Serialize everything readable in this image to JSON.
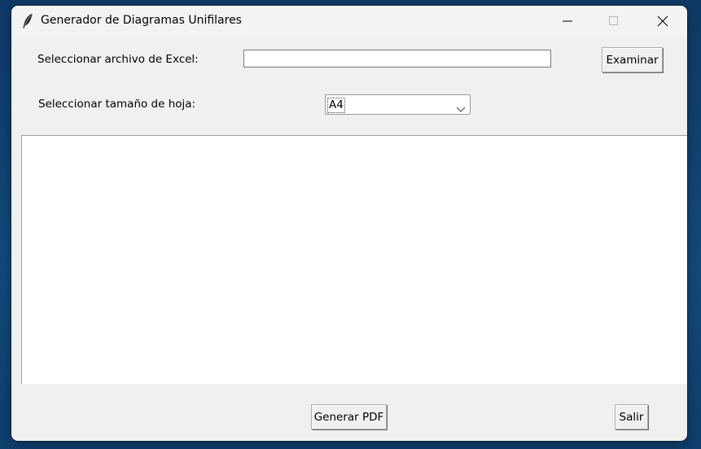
{
  "window": {
    "title": "Generador de Diagramas Unifilares",
    "app_icon": "feather-icon",
    "controls": {
      "minimize_icon": "minimize-icon",
      "maximize_icon": "maximize-icon",
      "close_icon": "close-icon"
    }
  },
  "form": {
    "excel_label": "Seleccionar archivo de Excel:",
    "excel_value": "",
    "browse_label": "Examinar",
    "size_label": "Seleccionar tamaño de hoja:",
    "size_selected": "A4",
    "dropdown_icon": "chevron-down-icon"
  },
  "output": {
    "text": ""
  },
  "footer": {
    "generate_label": "Generar PDF",
    "exit_label": "Salir"
  },
  "colors": {
    "desktop": "#103a66",
    "window_bg": "#f0f0f0",
    "titlebar_bg": "#f3f3f3",
    "text_area_bg": "#ffffff"
  }
}
